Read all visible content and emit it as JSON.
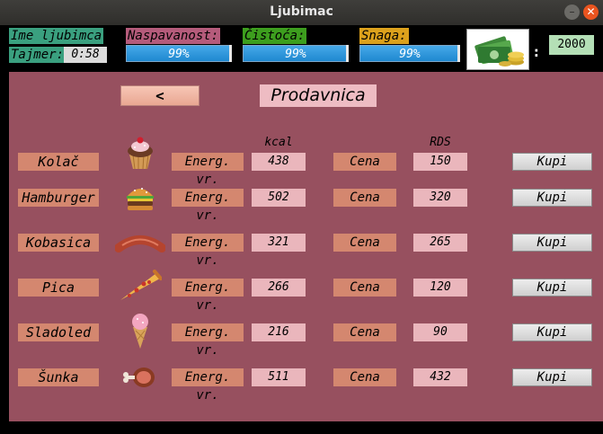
{
  "window": {
    "title": "Ljubimac"
  },
  "stats": {
    "name_label": "Ime ljubimca",
    "timer_label": "Tajmer:",
    "timer_value": "0:58",
    "sleep_label": "Naspavanost:",
    "sleep_value": "99%",
    "clean_label": "Čistoća:",
    "clean_value": "99%",
    "strength_label": "Snaga:",
    "strength_value": "99%",
    "colon": ":",
    "coins": "2000"
  },
  "shop": {
    "back_label": "<",
    "title": "Prodavnica",
    "kcal_header": "kcal",
    "rds_header": "RDS",
    "energy_label": "Energ. vr.",
    "price_label": "Cena",
    "buy_label": "Kupi",
    "items": [
      {
        "name": "Kolač",
        "icon": "cupcake-icon",
        "kcal": "438",
        "price": "150"
      },
      {
        "name": "Hamburger",
        "icon": "hamburger-icon",
        "kcal": "502",
        "price": "320"
      },
      {
        "name": "Kobasica",
        "icon": "sausage-icon",
        "kcal": "321",
        "price": "265"
      },
      {
        "name": "Pica",
        "icon": "pizza-icon",
        "kcal": "266",
        "price": "120"
      },
      {
        "name": "Sladoled",
        "icon": "ice-cream-icon",
        "kcal": "216",
        "price": "90"
      },
      {
        "name": "Šunka",
        "icon": "ham-icon",
        "kcal": "511",
        "price": "432"
      }
    ]
  },
  "colors": {
    "accent": "#97505f",
    "progress": "#2e95db"
  }
}
